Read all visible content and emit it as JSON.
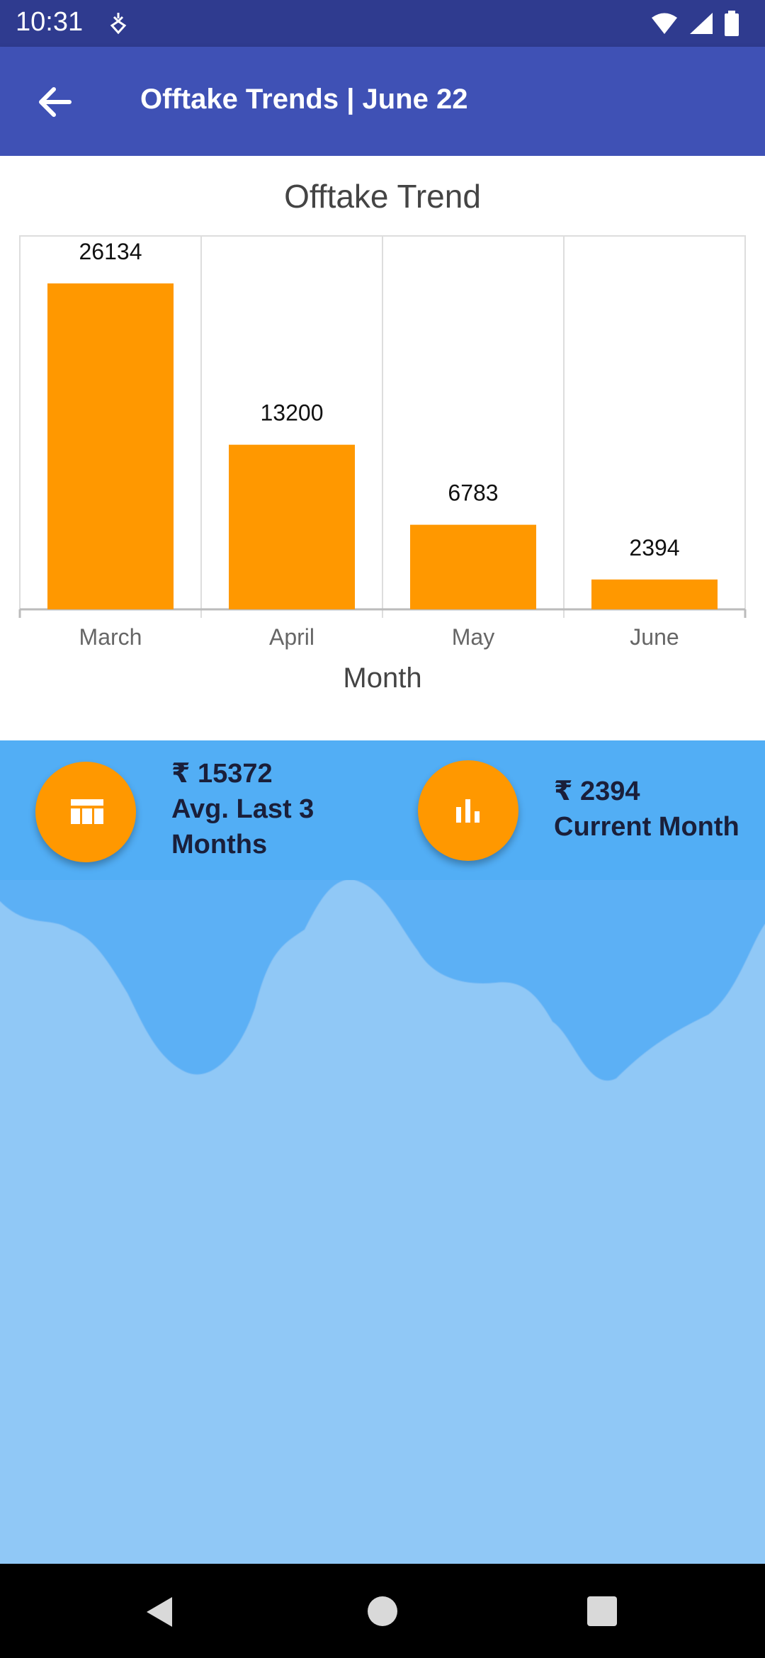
{
  "status_bar": {
    "time": "10:31"
  },
  "app_bar": {
    "title": "Offtake Trends | June 22"
  },
  "chart_data": {
    "type": "bar",
    "title": "Offtake Trend",
    "xlabel": "Month",
    "ylabel": "",
    "categories": [
      "March",
      "April",
      "May",
      "June"
    ],
    "values": [
      26134,
      13200,
      6783,
      2394
    ],
    "ylim": [
      0,
      26134
    ],
    "bar_color": "#ff9800",
    "grid": true
  },
  "stats": {
    "avg": {
      "amount": "₹ 15372",
      "label_line1": "Avg. Last 3",
      "label_line2": "Months",
      "icon": "table-icon"
    },
    "current": {
      "amount": "₹ 2394",
      "label": "Current Month",
      "icon": "bar-chart-icon"
    }
  },
  "colors": {
    "status_bar": "#2f3b8f",
    "app_bar": "#3f51b5",
    "accent": "#ff9800",
    "stats_band": "#52aef5",
    "wave_dark": "#5cb0f5",
    "wave_light": "#90c8f6"
  }
}
